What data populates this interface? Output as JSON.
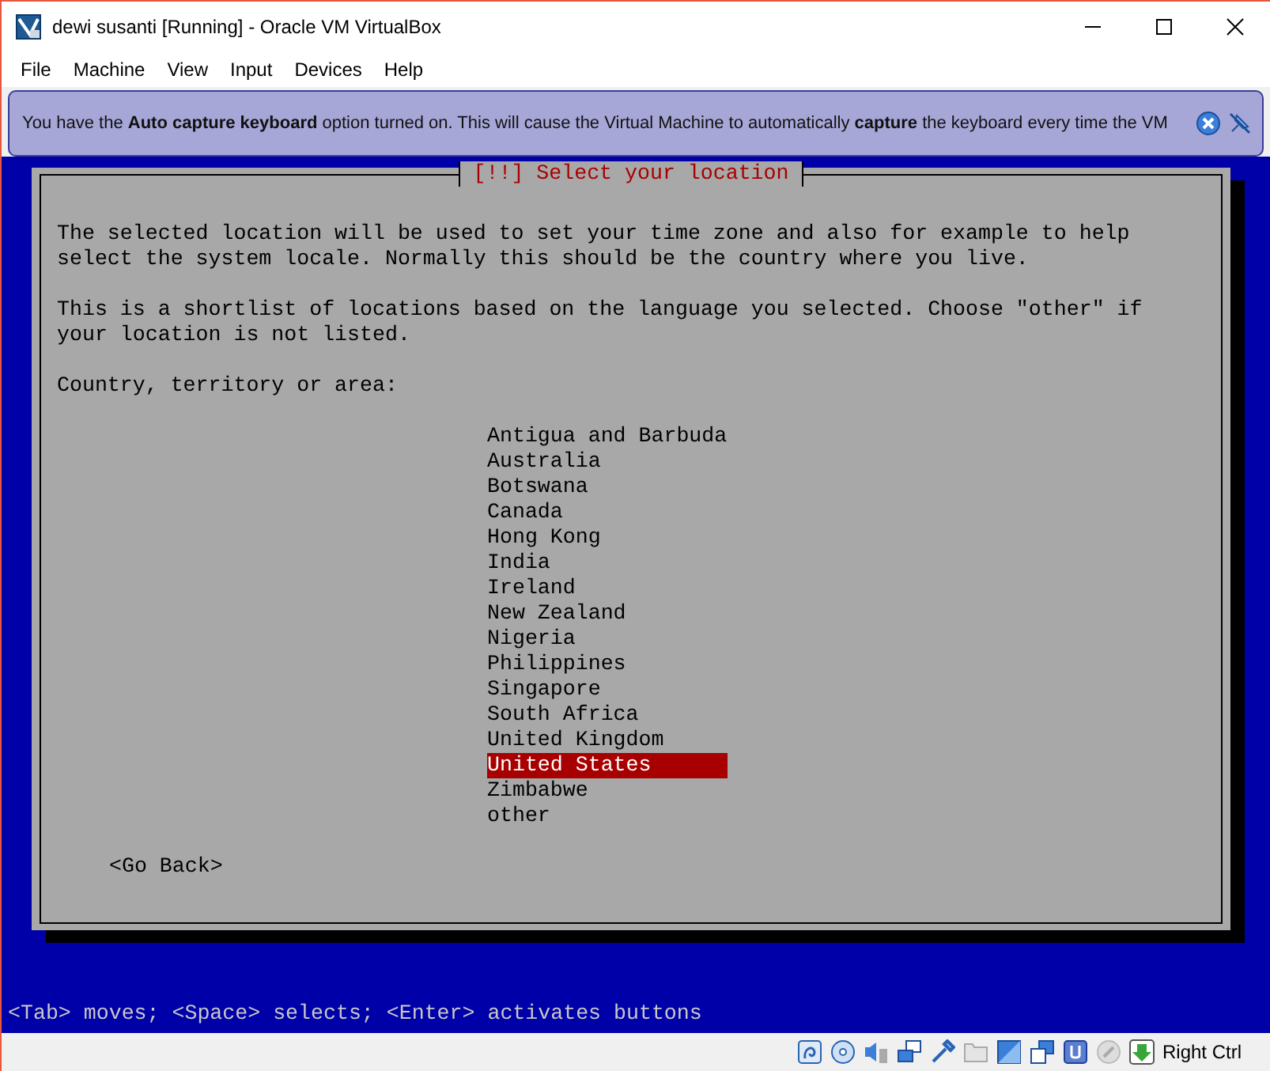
{
  "window": {
    "title": "dewi susanti [Running] - Oracle VM VirtualBox"
  },
  "menu": [
    "File",
    "Machine",
    "View",
    "Input",
    "Devices",
    "Help"
  ],
  "notification": {
    "text": "You have the **Auto capture keyboard** option turned on. This will cause the Virtual Machine to automatically **capture** the keyboard every time the VM"
  },
  "dialog": {
    "title": "[!!] Select your location",
    "paragraphs": [
      "The selected location will be used to set your time zone and also for example to help\nselect the system locale. Normally this should be the country where you live.",
      "This is a shortlist of locations based on the language you selected. Choose \"other\" if\nyour location is not listed."
    ],
    "prompt": "Country, territory or area:",
    "locations": [
      {
        "label": "Antigua and Barbuda",
        "selected": false
      },
      {
        "label": "Australia",
        "selected": false
      },
      {
        "label": "Botswana",
        "selected": false
      },
      {
        "label": "Canada",
        "selected": false
      },
      {
        "label": "Hong Kong",
        "selected": false
      },
      {
        "label": "India",
        "selected": false
      },
      {
        "label": "Ireland",
        "selected": false
      },
      {
        "label": "New Zealand",
        "selected": false
      },
      {
        "label": "Nigeria",
        "selected": false
      },
      {
        "label": "Philippines",
        "selected": false
      },
      {
        "label": "Singapore",
        "selected": false
      },
      {
        "label": "South Africa",
        "selected": false
      },
      {
        "label": "United Kingdom",
        "selected": false
      },
      {
        "label": "United States",
        "selected": true
      },
      {
        "label": "Zimbabwe",
        "selected": false
      },
      {
        "label": "other",
        "selected": false
      }
    ],
    "go_back": "<Go Back>"
  },
  "hint": "<Tab> moves; <Space> selects; <Enter> activates buttons",
  "status_bar": {
    "host_key": "Right Ctrl"
  }
}
